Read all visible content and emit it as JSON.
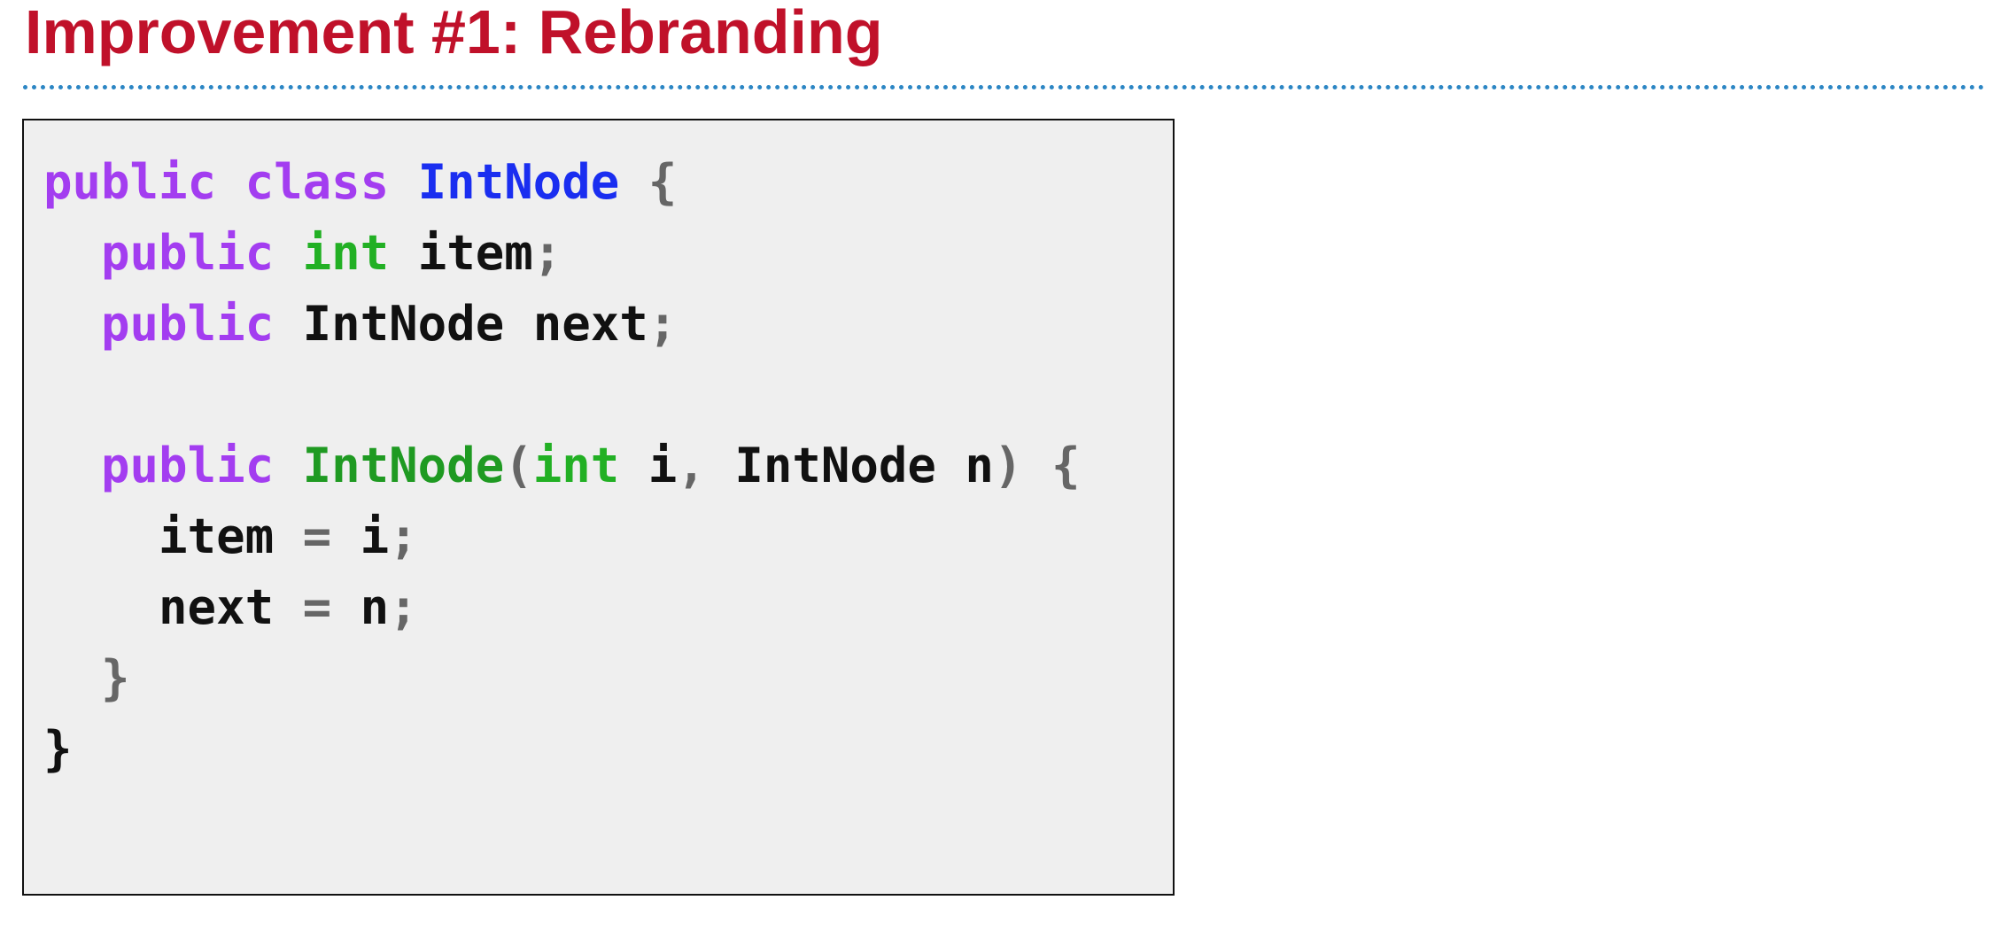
{
  "slide": {
    "title": "Improvement #1: Rebranding"
  },
  "colors": {
    "title": "#c0112a",
    "divider": "#2c86c4",
    "code_background": "#efefef",
    "keyword": "#a33df0",
    "type": "#22b024",
    "class_name": "#1a2ef0",
    "method_name": "#1f9a22",
    "punctuation": "#666666",
    "identifier": "#111111"
  },
  "code": {
    "language": "Java",
    "lines": [
      [
        {
          "text": "public",
          "kind": "keyword"
        },
        {
          "text": " ",
          "kind": "space"
        },
        {
          "text": "class",
          "kind": "keyword"
        },
        {
          "text": " ",
          "kind": "space"
        },
        {
          "text": "IntNode",
          "kind": "class_name"
        },
        {
          "text": " ",
          "kind": "space"
        },
        {
          "text": "{",
          "kind": "punctuation"
        }
      ],
      [
        {
          "text": "  ",
          "kind": "space"
        },
        {
          "text": "public",
          "kind": "keyword"
        },
        {
          "text": " ",
          "kind": "space"
        },
        {
          "text": "int",
          "kind": "type"
        },
        {
          "text": " ",
          "kind": "space"
        },
        {
          "text": "item",
          "kind": "identifier"
        },
        {
          "text": ";",
          "kind": "punctuation"
        }
      ],
      [
        {
          "text": "  ",
          "kind": "space"
        },
        {
          "text": "public",
          "kind": "keyword"
        },
        {
          "text": " ",
          "kind": "space"
        },
        {
          "text": "IntNode",
          "kind": "identifier"
        },
        {
          "text": " ",
          "kind": "space"
        },
        {
          "text": "next",
          "kind": "identifier"
        },
        {
          "text": ";",
          "kind": "punctuation"
        }
      ],
      [],
      [
        {
          "text": "  ",
          "kind": "space"
        },
        {
          "text": "public",
          "kind": "keyword"
        },
        {
          "text": " ",
          "kind": "space"
        },
        {
          "text": "IntNode",
          "kind": "method_name"
        },
        {
          "text": "(",
          "kind": "punctuation"
        },
        {
          "text": "int",
          "kind": "type"
        },
        {
          "text": " ",
          "kind": "space"
        },
        {
          "text": "i",
          "kind": "identifier"
        },
        {
          "text": ",",
          "kind": "punctuation"
        },
        {
          "text": " ",
          "kind": "space"
        },
        {
          "text": "IntNode",
          "kind": "identifier"
        },
        {
          "text": " ",
          "kind": "space"
        },
        {
          "text": "n",
          "kind": "identifier"
        },
        {
          "text": ")",
          "kind": "punctuation"
        },
        {
          "text": " ",
          "kind": "space"
        },
        {
          "text": "{",
          "kind": "punctuation"
        }
      ],
      [
        {
          "text": "    ",
          "kind": "space"
        },
        {
          "text": "item",
          "kind": "identifier"
        },
        {
          "text": " ",
          "kind": "space"
        },
        {
          "text": "=",
          "kind": "punctuation"
        },
        {
          "text": " ",
          "kind": "space"
        },
        {
          "text": "i",
          "kind": "identifier"
        },
        {
          "text": ";",
          "kind": "punctuation"
        }
      ],
      [
        {
          "text": "    ",
          "kind": "space"
        },
        {
          "text": "next",
          "kind": "identifier"
        },
        {
          "text": " ",
          "kind": "space"
        },
        {
          "text": "=",
          "kind": "punctuation"
        },
        {
          "text": " ",
          "kind": "space"
        },
        {
          "text": "n",
          "kind": "identifier"
        },
        {
          "text": ";",
          "kind": "punctuation"
        }
      ],
      [
        {
          "text": "  ",
          "kind": "space"
        },
        {
          "text": "}",
          "kind": "punctuation"
        }
      ],
      [
        {
          "text": "}",
          "kind": "identifier"
        }
      ]
    ]
  }
}
